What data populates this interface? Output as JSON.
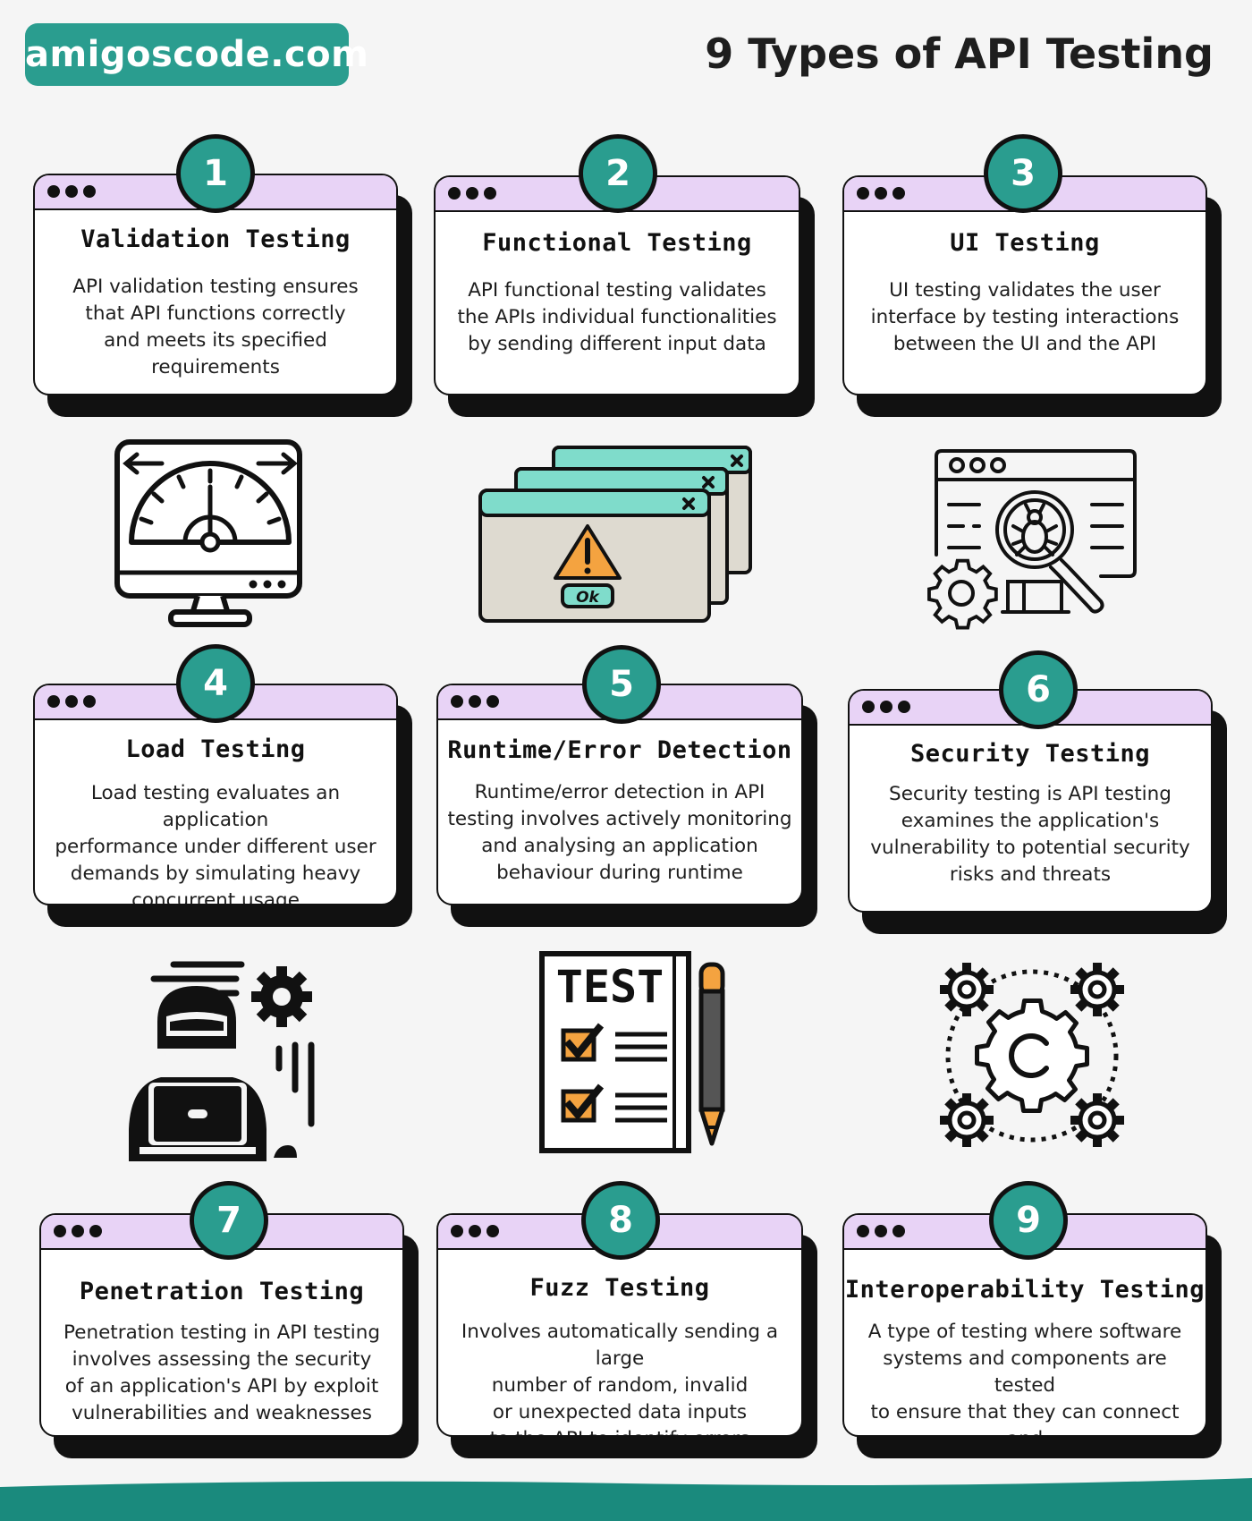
{
  "brand": "amigoscode.com",
  "title": "9 Types of API Testing",
  "colors": {
    "accent": "#2a9d8f",
    "titlebar": "#e8d3f6",
    "ink": "#111111",
    "orange": "#f4a340",
    "teal_light": "#7fdccb",
    "window_body": "#dedad0"
  },
  "cards": [
    {
      "number": "1",
      "title": "Validation Testing",
      "description": "API validation testing ensures\nthat API functions correctly\nand meets its specified\nrequirements"
    },
    {
      "number": "2",
      "title": "Functional Testing",
      "description": "API functional testing validates\nthe APIs individual functionalities\nby sending different input data"
    },
    {
      "number": "3",
      "title": "UI Testing",
      "description": "UI testing validates the user\ninterface by testing interactions\nbetween the UI and the API"
    },
    {
      "number": "4",
      "title": "Load Testing",
      "description": "Load testing evaluates an application\nperformance under different user\ndemands by simulating heavy\nconcurrent usage"
    },
    {
      "number": "5",
      "title": "Runtime/Error Detection",
      "description": "Runtime/error detection in API\ntesting involves actively monitoring\nand analysing an application\nbehaviour during runtime"
    },
    {
      "number": "6",
      "title": "Security Testing",
      "description": "Security testing is API testing\nexamines the application's\nvulnerability to potential security\nrisks and threats"
    },
    {
      "number": "7",
      "title": "Penetration Testing",
      "description": "Penetration testing in API testing\ninvolves assessing the security\nof an application's API by exploit\nvulnerabilities and weaknesses"
    },
    {
      "number": "8",
      "title": "Fuzz Testing",
      "description": "Involves automatically sending a large\nnumber of random, invalid\nor unexpected data inputs\nto the API to identify errors"
    },
    {
      "number": "9",
      "title": "Interoperability Testing",
      "description": "A type of testing where software\nsystems and components are tested\nto ensure that they can connect and\ncommunicate with each other"
    }
  ],
  "icons": {
    "speedometer": "speedometer-monitor-icon",
    "error_windows": "error-windows-icon",
    "ui_bug_search": "ui-bug-search-icon",
    "hacker": "hacker-laptop-icon",
    "test_checklist": "test-checklist-icon",
    "gears": "gears-network-icon"
  },
  "test_sheet_label": "TEST",
  "ok_label": "Ok"
}
